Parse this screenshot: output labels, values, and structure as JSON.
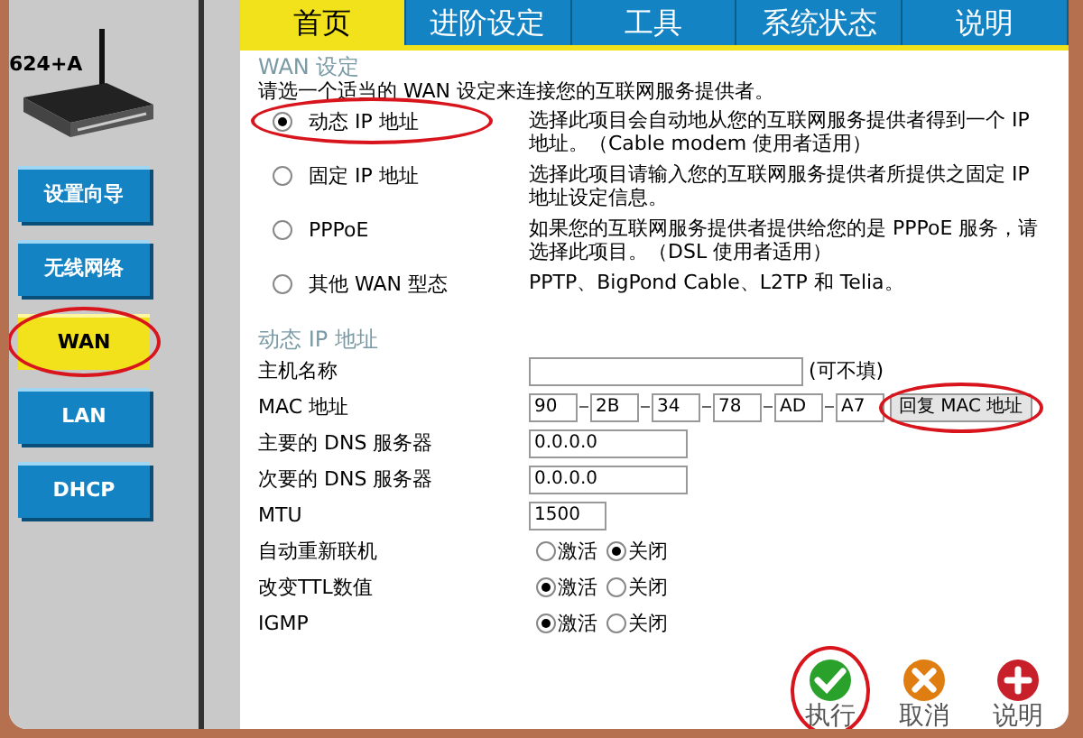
{
  "device_model": "624+A",
  "nav": [
    {
      "label": "设置向导",
      "highlighted": false
    },
    {
      "label": "无线网络",
      "highlighted": false
    },
    {
      "label": "WAN",
      "selected": true,
      "highlighted": true
    },
    {
      "label": "LAN",
      "selected": false,
      "highlighted": false
    },
    {
      "label": "DHCP",
      "selected": false,
      "highlighted": false
    }
  ],
  "tabs": [
    {
      "label": "首页",
      "selected": true
    },
    {
      "label": "进阶设定",
      "selected": false
    },
    {
      "label": "工具",
      "selected": false
    },
    {
      "label": "系统状态",
      "selected": false
    },
    {
      "label": "说明",
      "selected": false
    }
  ],
  "wan_section": {
    "title": "WAN 设定",
    "intro": "请选一个适当的 WAN 设定来连接您的互联网服务提供者。",
    "options": [
      {
        "label": "动态 IP 地址",
        "description": "选择此项目会自动地从您的互联网服务提供者得到一个 IP 地址。（Cable modem 使用者适用）",
        "selected": true,
        "highlighted": true
      },
      {
        "label": "固定 IP 地址",
        "description": "选择此项目请输入您的互联网服务提供者所提供之固定 IP 地址设定信息。",
        "selected": false,
        "highlighted": false
      },
      {
        "label": "PPPoE",
        "description": "如果您的互联网服务提供者提供给您的是 PPPoE 服务，请选择此项目。（DSL 使用者适用）",
        "selected": false,
        "highlighted": false
      },
      {
        "label": "其他 WAN 型态",
        "description": "PPTP、BigPond Cable、L2TP 和 Telia。",
        "selected": false,
        "highlighted": false
      }
    ]
  },
  "dynamic_section": {
    "title": "动态 IP 地址",
    "rows": [
      {
        "kind": "text_long",
        "label": "主机名称",
        "hint": "(可不填)"
      },
      {
        "kind": "mac",
        "label": "MAC 地址",
        "parts": [
          "90",
          "2B",
          "34",
          "78",
          "AD",
          "A7"
        ],
        "button": {
          "label": "回复 MAC 地址",
          "highlighted": true
        }
      },
      {
        "kind": "text",
        "label": "主要的 DNS 服务器",
        "value": "0.0.0.0"
      },
      {
        "kind": "text",
        "label": "次要的 DNS 服务器",
        "value": "0.0.0.0"
      },
      {
        "kind": "text_short",
        "label": "MTU",
        "value": "1500"
      },
      {
        "kind": "toggle",
        "label": "自动重新联机",
        "options": [
          {
            "label": "激活",
            "selected": false
          },
          {
            "label": "关闭",
            "selected": true
          }
        ]
      },
      {
        "kind": "toggle",
        "label": "改变TTL数值",
        "options": [
          {
            "label": "激活",
            "selected": true
          },
          {
            "label": "关闭",
            "selected": false
          }
        ]
      },
      {
        "kind": "toggle",
        "label": "IGMP",
        "options": [
          {
            "label": "激活",
            "selected": true
          },
          {
            "label": "关闭",
            "selected": false
          }
        ]
      }
    ]
  },
  "actions": [
    {
      "kind": "ok",
      "label": "执行",
      "highlighted": true
    },
    {
      "kind": "cancel",
      "label": "取消",
      "highlighted": false
    },
    {
      "kind": "help",
      "label": "说明",
      "highlighted": false
    }
  ]
}
